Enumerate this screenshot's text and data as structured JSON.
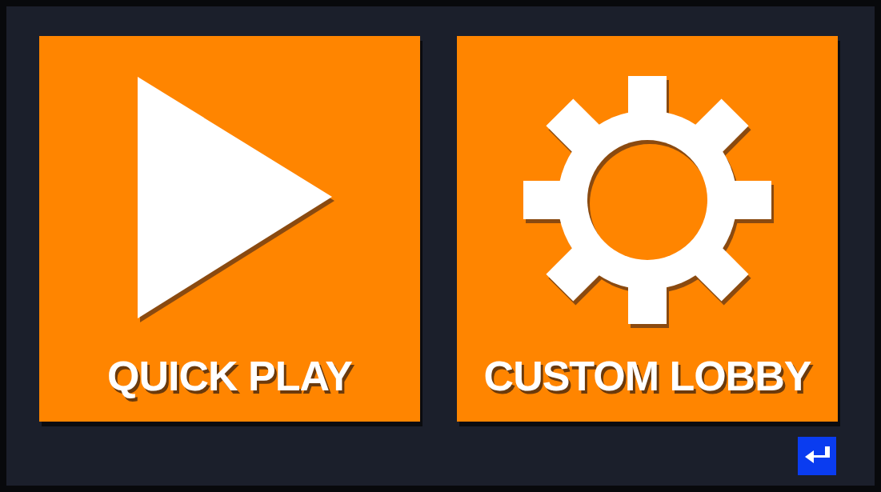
{
  "tiles": [
    {
      "kind": "play",
      "label": "QUICK PLAY"
    },
    {
      "kind": "gear",
      "label": "CUSTOM LOBBY"
    }
  ]
}
